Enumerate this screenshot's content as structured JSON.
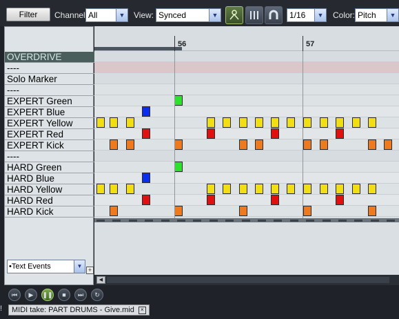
{
  "toolbar": {
    "filter_label": "Filter",
    "channel_label": "Channel:",
    "channel_value": "All",
    "view_label": "View:",
    "view_value": "Synced",
    "grid_value": "1/16",
    "color_label": "Color:",
    "color_value": "Pitch"
  },
  "ruler": {
    "marks": [
      "56",
      "57"
    ]
  },
  "lanes": [
    "OVERDRIVE",
    "----",
    "Solo Marker",
    "----",
    "EXPERT Green",
    "EXPERT Blue",
    "EXPERT Yellow",
    "EXPERT Red",
    "EXPERT Kick",
    "----",
    "HARD Green",
    "HARD Blue",
    "HARD Yellow",
    "HARD Red",
    "HARD Kick"
  ],
  "cc_selector": {
    "value": "•Text Events"
  },
  "status": {
    "tab_label": "MIDI take: PART DRUMS - Give.mid"
  },
  "colors": {
    "green": "#2fe02f",
    "blue": "#0a2ef0",
    "yellow": "#f2de14",
    "red": "#e01010",
    "orange": "#ee7a20"
  }
}
